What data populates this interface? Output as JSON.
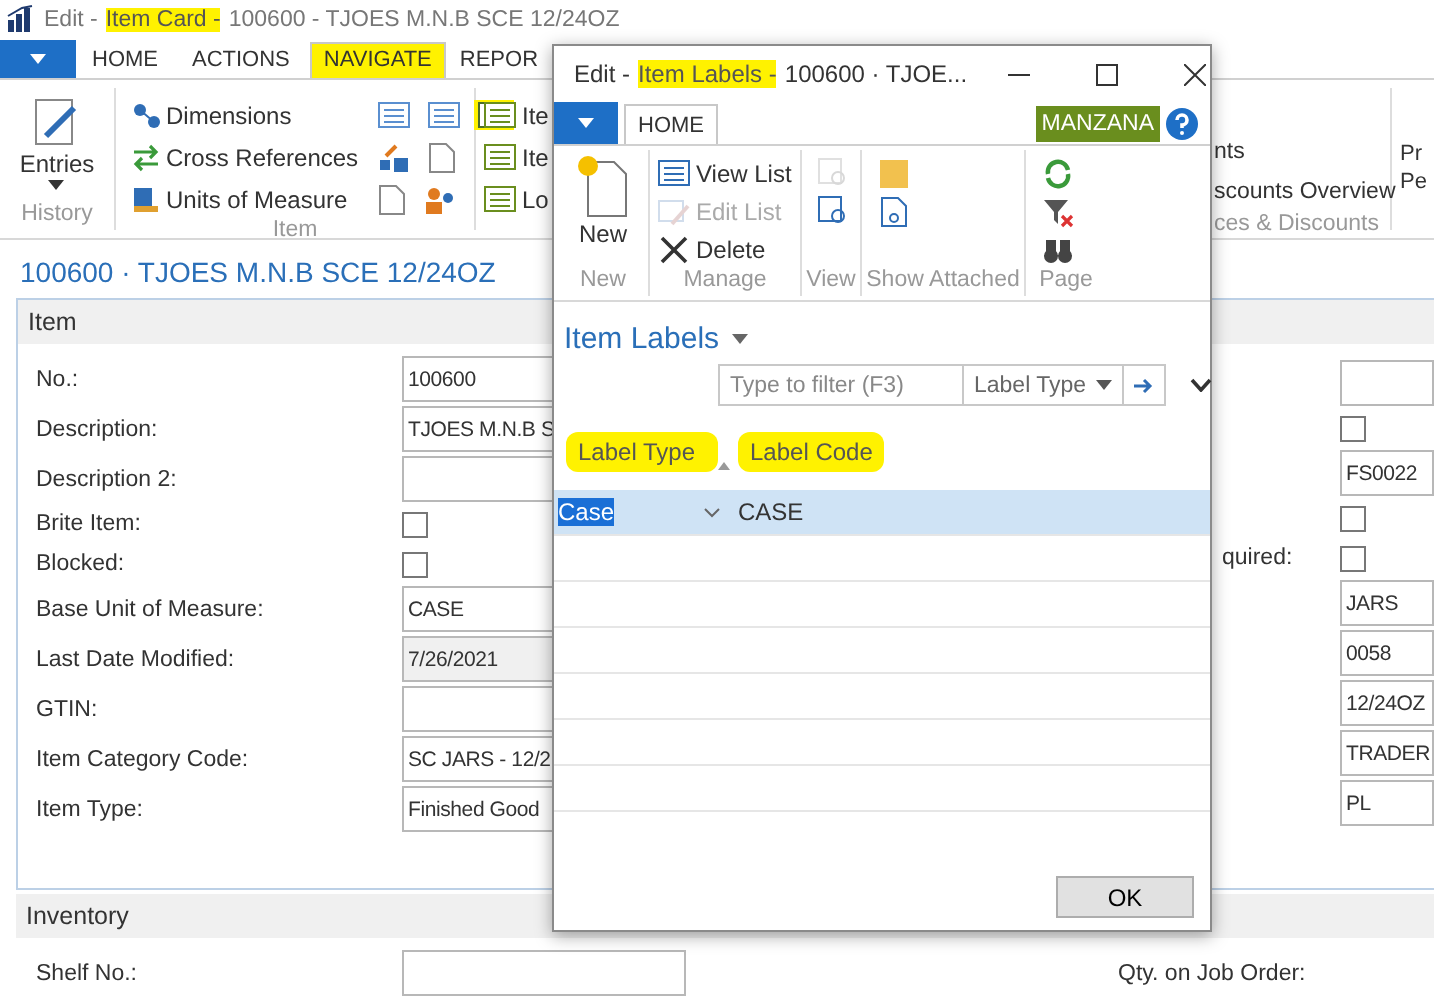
{
  "window": {
    "title_segments": [
      {
        "text": "Edit -",
        "highlighted": false
      },
      {
        "text": "Item Card -",
        "highlighted": true
      },
      {
        "text": "100600 - TJOES M.N.B SCE 12/24OZ",
        "highlighted": false
      }
    ]
  },
  "tabs": [
    {
      "label": "HOME",
      "selected": false,
      "highlighted": false
    },
    {
      "label": "ACTIONS",
      "selected": false,
      "highlighted": false
    },
    {
      "label": "NAVIGATE",
      "selected": true,
      "highlighted": true
    },
    {
      "label": "REPOR",
      "selected": false,
      "highlighted": false
    }
  ],
  "ribbon": {
    "history": {
      "command": "Entries",
      "label": "History"
    },
    "item": {
      "commands": [
        "Dimensions",
        "Cross References",
        "Units of Measure"
      ],
      "small_icon_rows": [
        [
          {
            "highlighted": false
          },
          {
            "highlighted": false
          },
          {
            "highlighted": true
          }
        ],
        [
          {
            "highlighted": false
          },
          {
            "highlighted": false
          }
        ],
        [
          {
            "highlighted": false
          },
          {
            "highlighted": false
          }
        ]
      ],
      "label": "Item"
    },
    "partial_commands": [
      "Ite",
      "Ite",
      "Lo"
    ],
    "prices": {
      "commands": [
        "nts",
        "scounts Overview"
      ],
      "label": "ces & Discounts"
    },
    "cut_commands": [
      "Pr",
      "Pe"
    ]
  },
  "page_title": "100600 · TJOES M.N.B SCE 12/24OZ",
  "item_section": {
    "title": "Item",
    "left_fields": [
      {
        "label": "No.:",
        "kind": "field",
        "value": "100600",
        "readonly": false
      },
      {
        "label": "Description:",
        "kind": "field",
        "value": "TJOES M.N.B S",
        "readonly": false
      },
      {
        "label": "Description 2:",
        "kind": "field",
        "readonly": false
      },
      {
        "label": "Brite Item:",
        "kind": "checkbox",
        "checked": false
      },
      {
        "label": "Blocked:",
        "kind": "checkbox",
        "checked": false
      },
      {
        "label": "Base Unit of Measure:",
        "kind": "field",
        "value": "CASE",
        "readonly": false
      },
      {
        "label": "Last Date Modified:",
        "kind": "field",
        "value": "7/26/2021",
        "readonly": true
      },
      {
        "label": "GTIN:",
        "kind": "field",
        "readonly": false
      },
      {
        "label": "Item Category Code:",
        "kind": "field",
        "value": "SC JARS - 12/2",
        "readonly": false
      },
      {
        "label": "Item Type:",
        "kind": "field",
        "value": "Finished Good",
        "readonly": false
      }
    ],
    "right_fields": [
      {
        "kind": "field"
      },
      {
        "kind": "checkbox",
        "checked": false
      },
      {
        "kind": "field",
        "value": "FS0022"
      },
      {
        "kind": "checkbox",
        "checked": false
      },
      {
        "kind": "checkbox",
        "checked": false,
        "label": "quired:"
      },
      {
        "kind": "field",
        "value": "JARS"
      },
      {
        "kind": "field",
        "value": "0058"
      },
      {
        "kind": "field",
        "value": "12/24OZ"
      },
      {
        "kind": "field",
        "value": "TRADER"
      },
      {
        "kind": "field",
        "value": "PL"
      }
    ]
  },
  "inventory_section": {
    "title": "Inventory",
    "shelf_label": "Shelf No.:",
    "qty_label": "Qty. on Job Order:"
  },
  "dialog": {
    "title_segments": [
      {
        "text": "Edit -",
        "highlighted": false
      },
      {
        "text": "Item Labels -",
        "highlighted": true
      },
      {
        "text": "100600 · TJOE...",
        "highlighted": false
      }
    ],
    "tabs": [
      {
        "label": "HOME",
        "selected": true
      }
    ],
    "company": "MANZANA",
    "ribbon_groups": [
      {
        "label": "New",
        "items": [
          {
            "kind": "large",
            "label": "New",
            "disabled": false
          }
        ]
      },
      {
        "label": "Manage",
        "items": [
          {
            "kind": "small",
            "label": "View List",
            "disabled": false
          },
          {
            "kind": "small",
            "label": "Edit List",
            "disabled": true
          },
          {
            "kind": "small",
            "label": "Delete",
            "disabled": false
          }
        ]
      },
      {
        "label": "View",
        "items": [
          {
            "kind": "icon",
            "disabled": true
          },
          {
            "kind": "icon",
            "disabled": false
          }
        ]
      },
      {
        "label": "Show Attached",
        "items": [
          {
            "kind": "icon",
            "disabled": false
          },
          {
            "kind": "icon",
            "disabled": false
          }
        ]
      },
      {
        "label": "Page",
        "items": [
          {
            "kind": "icon",
            "disabled": false
          },
          {
            "kind": "icon",
            "disabled": false
          },
          {
            "kind": "icon",
            "disabled": false
          }
        ]
      }
    ],
    "list_title": "Item Labels",
    "filter": {
      "placeholder": "Type to filter (F3)",
      "column": "Label Type"
    },
    "columns": [
      {
        "label": "Label Type",
        "highlighted": true,
        "sorted": true
      },
      {
        "label": "Label Code",
        "highlighted": true,
        "sorted": false
      }
    ],
    "rows": [
      {
        "label_type": "Case",
        "label_code": "CASE",
        "selected": true
      }
    ],
    "ok_button": "OK"
  }
}
